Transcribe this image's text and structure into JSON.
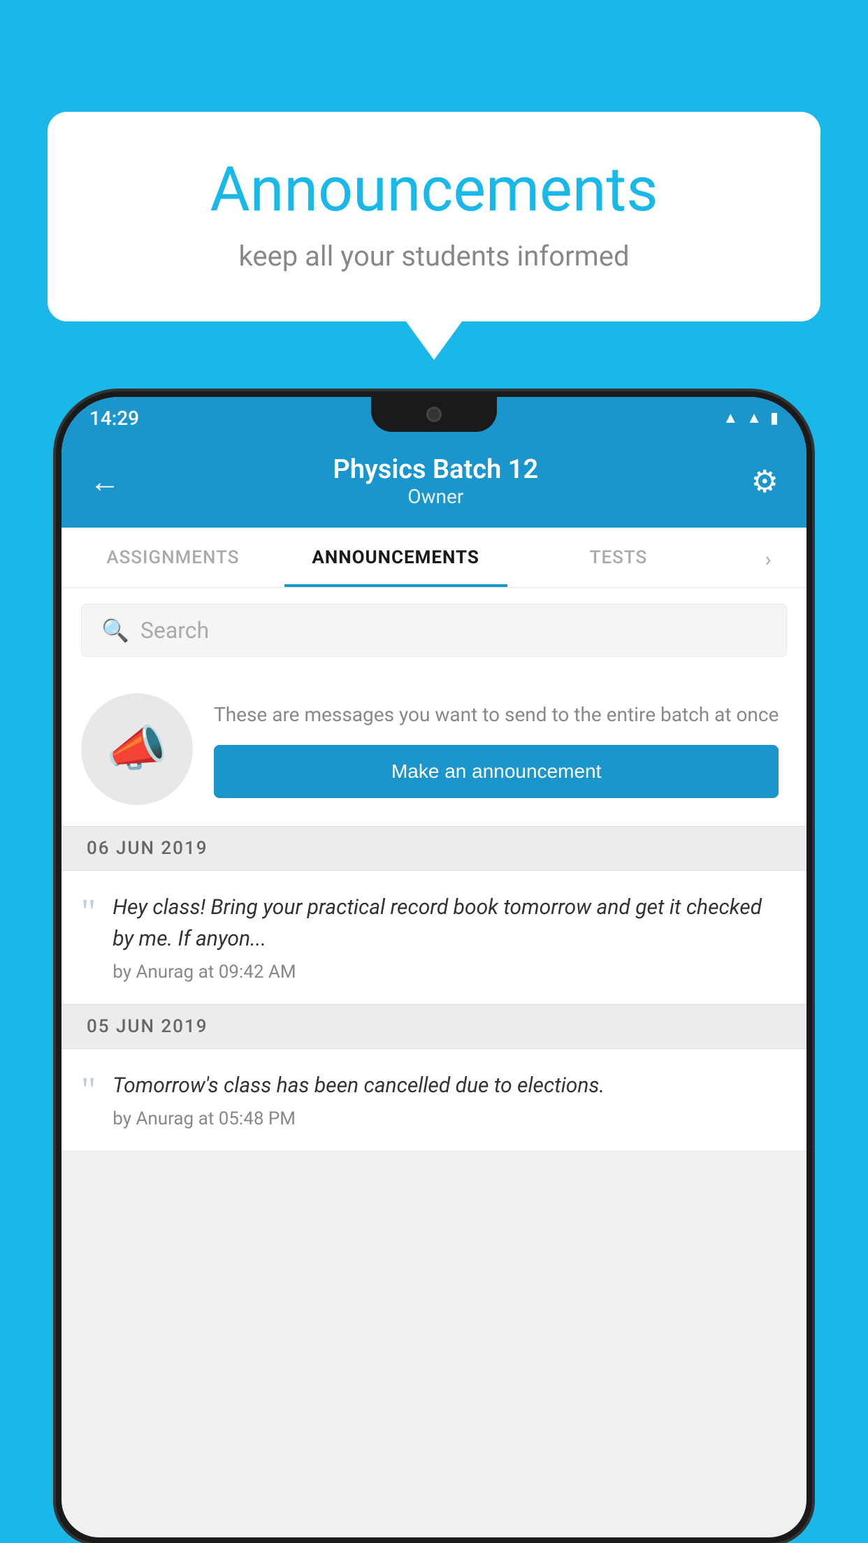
{
  "background_color": "#1ab8e8",
  "speech_bubble": {
    "title": "Announcements",
    "subtitle": "keep all your students informed"
  },
  "status_bar": {
    "time": "14:29",
    "icons": [
      "wifi",
      "signal",
      "battery"
    ]
  },
  "header": {
    "title": "Physics Batch 12",
    "subtitle": "Owner",
    "back_label": "←",
    "settings_label": "⚙"
  },
  "tabs": [
    {
      "label": "ASSIGNMENTS",
      "active": false
    },
    {
      "label": "ANNOUNCEMENTS",
      "active": true
    },
    {
      "label": "TESTS",
      "active": false
    }
  ],
  "search": {
    "placeholder": "Search"
  },
  "announcement_prompt": {
    "description": "These are messages you want to send to the entire batch at once",
    "button_label": "Make an announcement"
  },
  "announcements": [
    {
      "date": "06  JUN  2019",
      "text": "Hey class! Bring your practical record book tomorrow and get it checked by me. If anyon...",
      "by": "by Anurag at 09:42 AM"
    },
    {
      "date": "05  JUN  2019",
      "text": "Tomorrow's class has been cancelled due to elections.",
      "by": "by Anurag at 05:48 PM"
    }
  ]
}
